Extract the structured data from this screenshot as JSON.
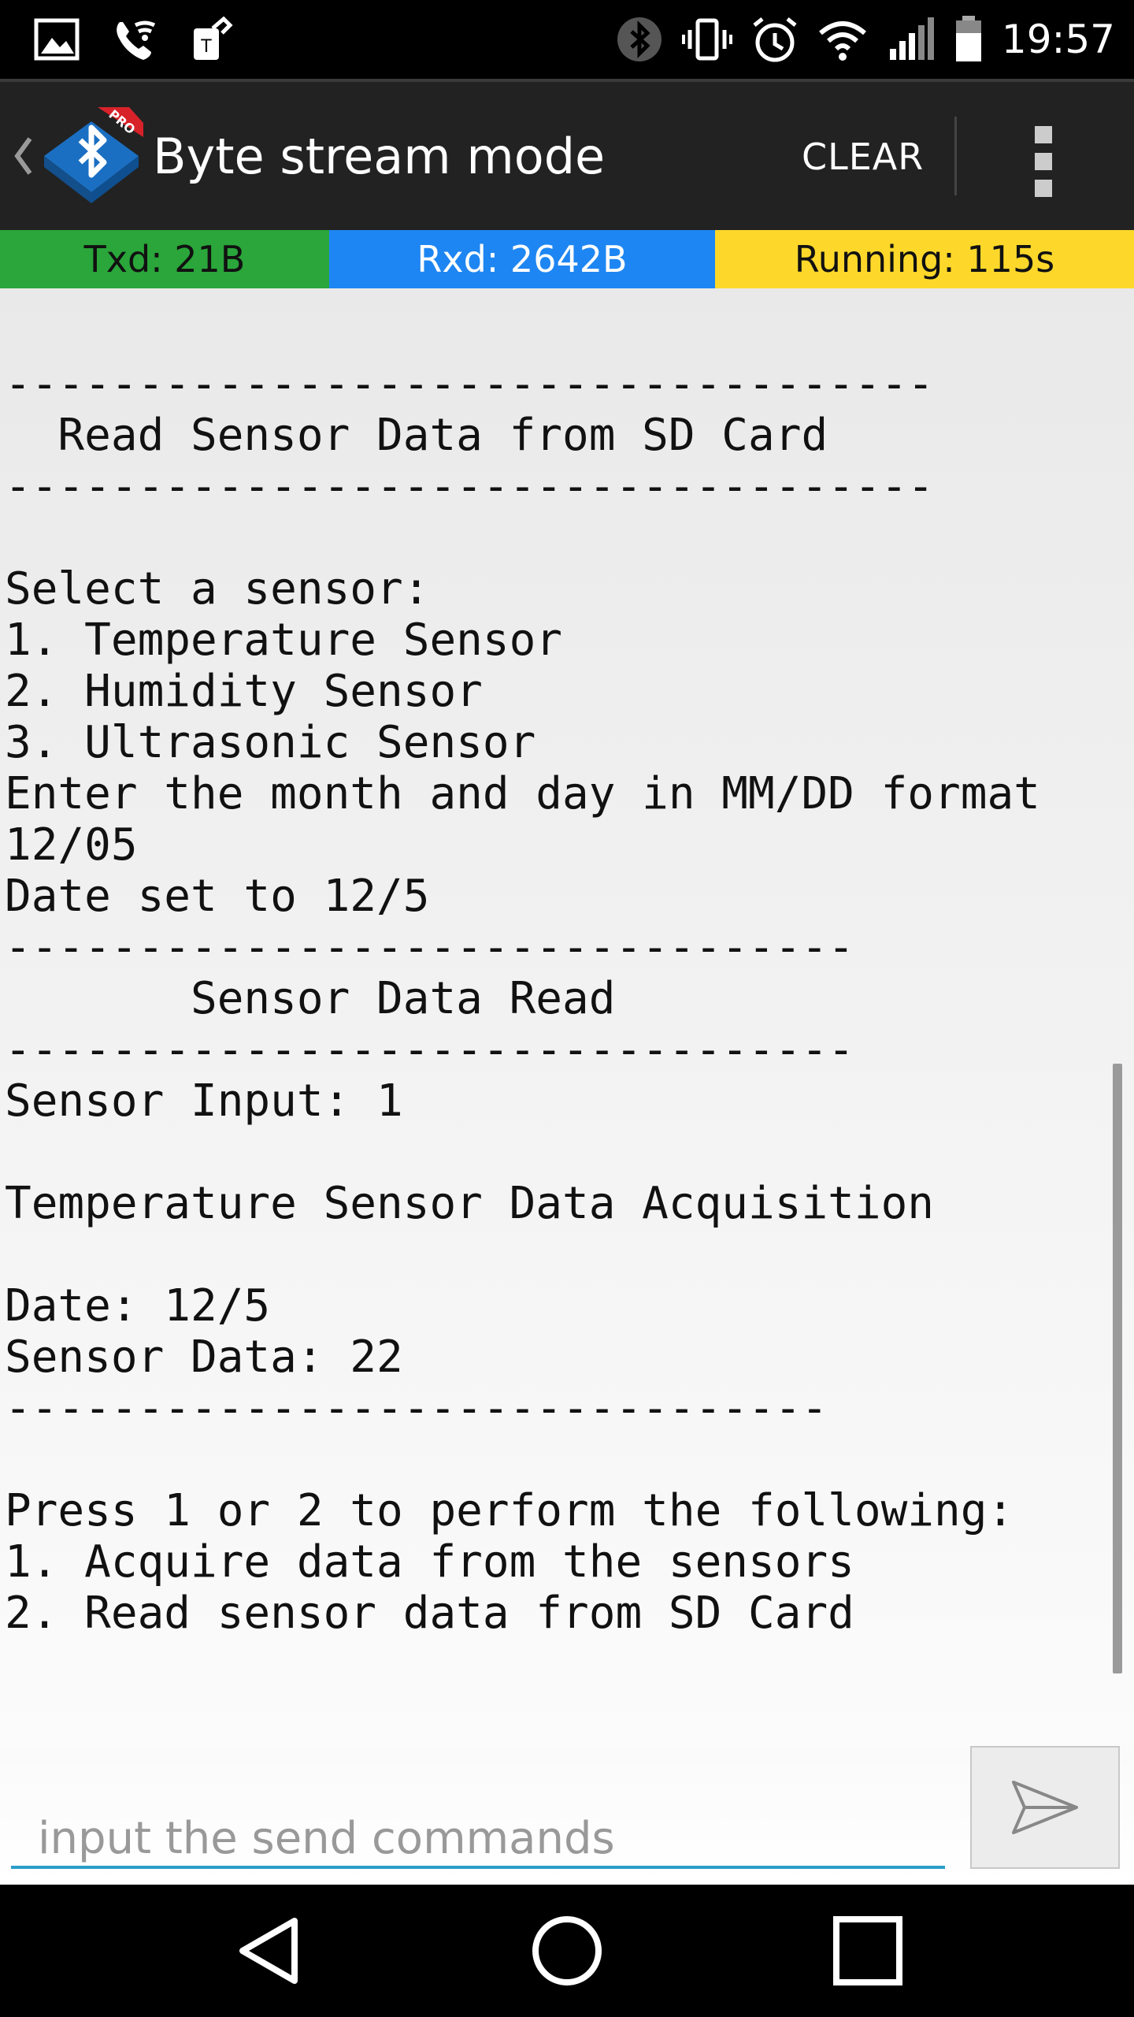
{
  "status_bar": {
    "time": "19:57",
    "left_icons": [
      "image-icon",
      "wifi-calling-icon",
      "t-mobile-icon"
    ],
    "right_icons": [
      "bluetooth-icon",
      "vibrate-icon",
      "alarm-icon",
      "wifi-icon",
      "signal-icon",
      "battery-icon"
    ]
  },
  "app_bar": {
    "back_icon": "chevron-left-icon",
    "logo_icon": "bluetooth-pro-logo",
    "logo_badge": "PRO",
    "title": "Byte stream mode",
    "clear_label": "CLEAR",
    "overflow_icon": "more-vertical-icon"
  },
  "stats": {
    "tx": "Txd: 21B",
    "rx": "Rxd: 2642B",
    "running": "Running: 115s",
    "colors": {
      "tx": "#2aa63a",
      "rx": "#1e86f2",
      "running": "#fdd82a"
    }
  },
  "terminal": {
    "lines": [
      "-----------------------------------",
      "  Read Sensor Data from SD Card",
      "-----------------------------------",
      "",
      "Select a sensor:",
      "1. Temperature Sensor",
      "2. Humidity Sensor",
      "3. Ultrasonic Sensor",
      "Enter the month and day in MM/DD format",
      "12/05",
      "Date set to 12/5",
      "--------------------------------",
      "       Sensor Data Read",
      "--------------------------------",
      "Sensor Input: 1",
      "",
      "Temperature Sensor Data Acquisition",
      "",
      "Date: 12/5",
      "Sensor Data: 22",
      "-------------------------------",
      "",
      "Press 1 or 2 to perform the following:",
      "1. Acquire data from the sensors",
      "2. Read sensor data from SD Card"
    ]
  },
  "input": {
    "placeholder": "input the send commands",
    "value": "",
    "send_icon": "send-icon"
  },
  "nav_bar": {
    "back_icon": "nav-back-icon",
    "home_icon": "nav-home-icon",
    "recents_icon": "nav-recents-icon"
  }
}
